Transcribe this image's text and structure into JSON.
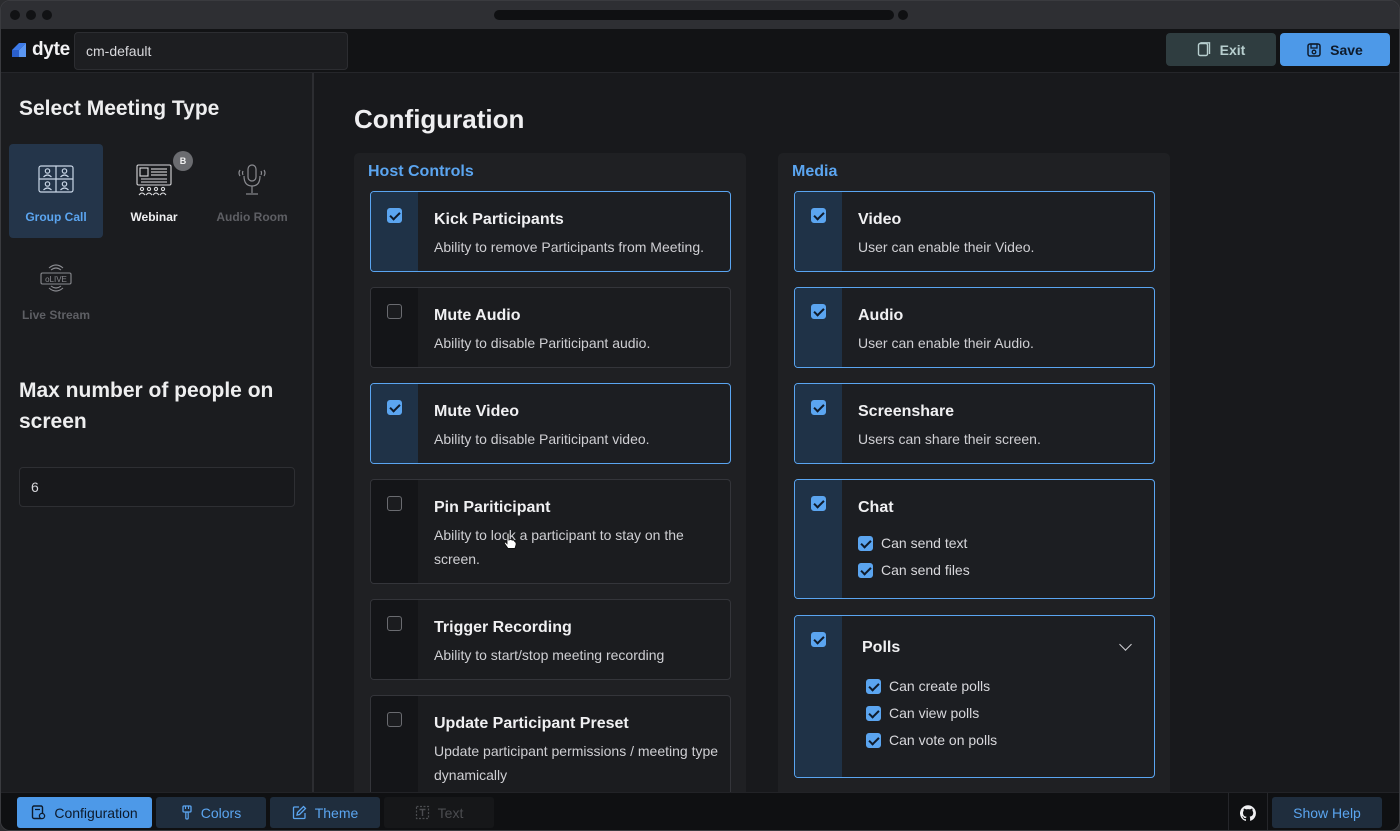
{
  "header": {
    "logo_text": "dyte",
    "preset_name": "cm-default",
    "exit_label": "Exit",
    "save_label": "Save"
  },
  "sidebar": {
    "title": "Select Meeting Type",
    "meeting_types": [
      {
        "label": "Group Call",
        "state": "selected",
        "icon": "group-call-icon"
      },
      {
        "label": "Webinar",
        "state": "available",
        "icon": "webinar-icon",
        "badge": "B"
      },
      {
        "label": "Audio Room",
        "state": "disabled",
        "icon": "audio-room-icon"
      },
      {
        "label": "Live Stream",
        "state": "disabled",
        "icon": "live-stream-icon"
      }
    ],
    "max_people_title": "Max number of people on screen",
    "max_people_value": "6"
  },
  "main": {
    "title": "Configuration",
    "host_controls": {
      "title": "Host Controls",
      "options": [
        {
          "title": "Kick Participants",
          "desc": "Ability to remove Participants from Meeting.",
          "checked": true
        },
        {
          "title": "Mute Audio",
          "desc": "Ability to disable Pariticipant audio.",
          "checked": false
        },
        {
          "title": "Mute Video",
          "desc": "Ability to disable Pariticipant video.",
          "checked": true
        },
        {
          "title": "Pin Pariticipant",
          "desc": "Ability to lock a participant to stay on the screen.",
          "checked": false
        },
        {
          "title": "Trigger Recording",
          "desc": "Ability to start/stop meeting recording",
          "checked": false
        },
        {
          "title": "Update Participant Preset",
          "desc": "Update participant permissions / meeting type dynamically",
          "checked": false
        }
      ]
    },
    "media": {
      "title": "Media",
      "options": [
        {
          "title": "Video",
          "desc": "User can enable their Video.",
          "checked": true
        },
        {
          "title": "Audio",
          "desc": "User can enable their Audio.",
          "checked": true
        },
        {
          "title": "Screenshare",
          "desc": "Users can share their screen.",
          "checked": true
        },
        {
          "title": "Chat",
          "checked": true,
          "sub": [
            "Can send text",
            "Can send files"
          ]
        },
        {
          "title": "Polls",
          "checked": true,
          "sub": [
            "Can create polls",
            "Can view polls",
            "Can vote on polls"
          ]
        }
      ]
    }
  },
  "bottom": {
    "tabs": [
      {
        "label": "Configuration",
        "state": "active",
        "icon": "settings-doc-icon"
      },
      {
        "label": "Colors",
        "state": "normal",
        "icon": "paintbrush-icon"
      },
      {
        "label": "Theme",
        "state": "normal",
        "icon": "edit-icon"
      },
      {
        "label": "Text",
        "state": "disabled",
        "icon": "text-icon"
      }
    ],
    "help_label": "Show Help",
    "github_icon": "github-icon"
  },
  "colors": {
    "accent": "#5ba5f0",
    "primary_button": "#4d99e8",
    "background": "#18191c"
  }
}
